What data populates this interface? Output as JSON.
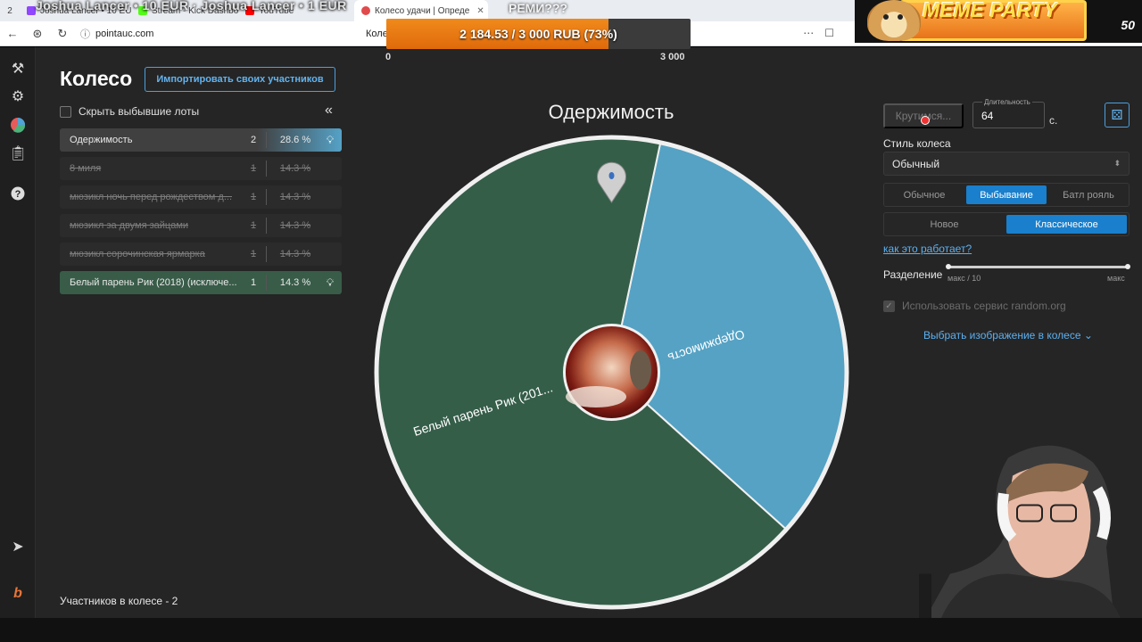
{
  "browser": {
    "tab_count": "2",
    "tabs": [
      {
        "title": "Joshua Lancer • 10 EUR",
        "color": "#9146ff",
        "active": false
      },
      {
        "title": "Stream - Kick Dashboard",
        "color": "#53fc18",
        "active": false
      },
      {
        "title": "YouTube",
        "color": "#ff0000",
        "active": false
      },
      {
        "title": "Колесо удачи | Опреде",
        "color": "#e14b4b",
        "active": true
      }
    ],
    "url": "pointauc.com",
    "page_title": "Колесо удачи | О"
  },
  "overlay": {
    "ticker": "Joshua Lancer • 10 EUR  ·  Joshua Lancer • 1 EUR",
    "ticker2": "РЕМИ???",
    "donation_text": "2 184.53 / 3 000 RUB (73%)",
    "donation_progress": 0.73,
    "scale_min": "0",
    "scale_max": "3 000",
    "meme_title": "MEME PARTY",
    "meme_sub": "50"
  },
  "sidebar_icons": [
    "gavel-icon",
    "gear-icon",
    "wheel-icon",
    "clipboard-icon",
    "help-icon",
    "telegram-icon",
    "brand-icon"
  ],
  "header": {
    "title": "Колесо",
    "import_label": "Импортировать своих участников"
  },
  "hide_label": "Скрыть выбывшие лоты",
  "collapse_label": "«",
  "lots": [
    {
      "name": "Одержимость",
      "amount": "2",
      "percent": "28.6 %",
      "state": "active-blue"
    },
    {
      "name": "8 миля",
      "amount": "1",
      "percent": "14.3 %",
      "state": "out"
    },
    {
      "name": "мюзикл ночь перед рождеством д...",
      "amount": "1",
      "percent": "14.3 %",
      "state": "out"
    },
    {
      "name": "мюзикл за двумя зайцами",
      "amount": "1",
      "percent": "14.3 %",
      "state": "out"
    },
    {
      "name": "мюзикл сорочинская ярмарка",
      "amount": "1",
      "percent": "14.3 %",
      "state": "out"
    },
    {
      "name": "Белый парень Рик (2018) (исключе...",
      "amount": "1",
      "percent": "14.3 %",
      "state": "active-green"
    }
  ],
  "participants_label": "Участников в колесе - 2",
  "wheel": {
    "winner": "Одержимость",
    "segments": [
      {
        "label": "Одержимость",
        "share": 0.3333,
        "color": "#55a2c4"
      },
      {
        "label": "Белый парень Рик (201...",
        "share": 0.6667,
        "color": "#355e49"
      }
    ]
  },
  "controls": {
    "spin_label": "Крутимся...",
    "duration_label": "Длительность",
    "duration_value": "64",
    "duration_unit": "с.",
    "style_label": "Стиль колеса",
    "style_value": "Обычный",
    "mode_options": [
      "Обычное",
      "Выбывание",
      "Батл рояль"
    ],
    "mode_selected": 1,
    "variant_options": [
      "Новое",
      "Классическое"
    ],
    "variant_selected": 1,
    "how_link": "как это работает?",
    "split_label": "Разделение",
    "split_min": "макс / 10",
    "split_max": "макс",
    "random_org_label": "Использовать сервис random.org",
    "choose_image_label": "Выбрать изображение в колесе"
  }
}
